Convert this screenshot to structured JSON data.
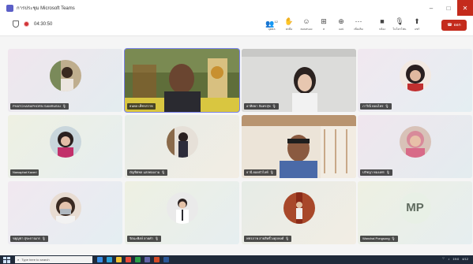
{
  "window": {
    "title": "การประชุม Microsoft Teams"
  },
  "controls": {
    "min": "–",
    "max": "□",
    "close": "✕"
  },
  "meeting": {
    "timer": "04:30:50"
  },
  "toolbar": {
    "people_count": "12",
    "people_label": "บุคคล",
    "raise_label": "ยกมือ",
    "reactions_label": "ตอบสนอง",
    "rooms_label": "ห",
    "apps_label": "แอป",
    "more_label": "เพิ่มเติม",
    "camera_label": "กล้อง",
    "mic_label": "ไมโครโฟน",
    "share_label": "แชร์",
    "leave_label": "ออก"
  },
  "participants": [
    {
      "name": "PHATCHARAPHORN SAMRUEAI"
    },
    {
      "name": "ธนพล เพ็ชรสวาท"
    },
    {
      "name": "อาทิตยา จันทรสุข"
    },
    {
      "name": "ภาวิณี ดอนไพร"
    },
    {
      "name": "Nawaphat Kaveri"
    },
    {
      "name": "บัญชิตพล แสงทองงาม"
    },
    {
      "name": "ธานี ยอดบัวไลท์"
    },
    {
      "name": "ปรัชญา ทองงศร"
    },
    {
      "name": "ขยุญชา สุขะกาจเกร"
    },
    {
      "name": "รัตนะพิงษ์ ลายคำ"
    },
    {
      "name": "พชรภาพ สายสิทธิ์วงศุภพงศ์"
    },
    {
      "name": "Wanchai Pongsong",
      "initials": "MP"
    }
  ],
  "taskbar": {
    "search_placeholder": "Type here to search",
    "time": "19:0",
    "date": "4/12"
  }
}
